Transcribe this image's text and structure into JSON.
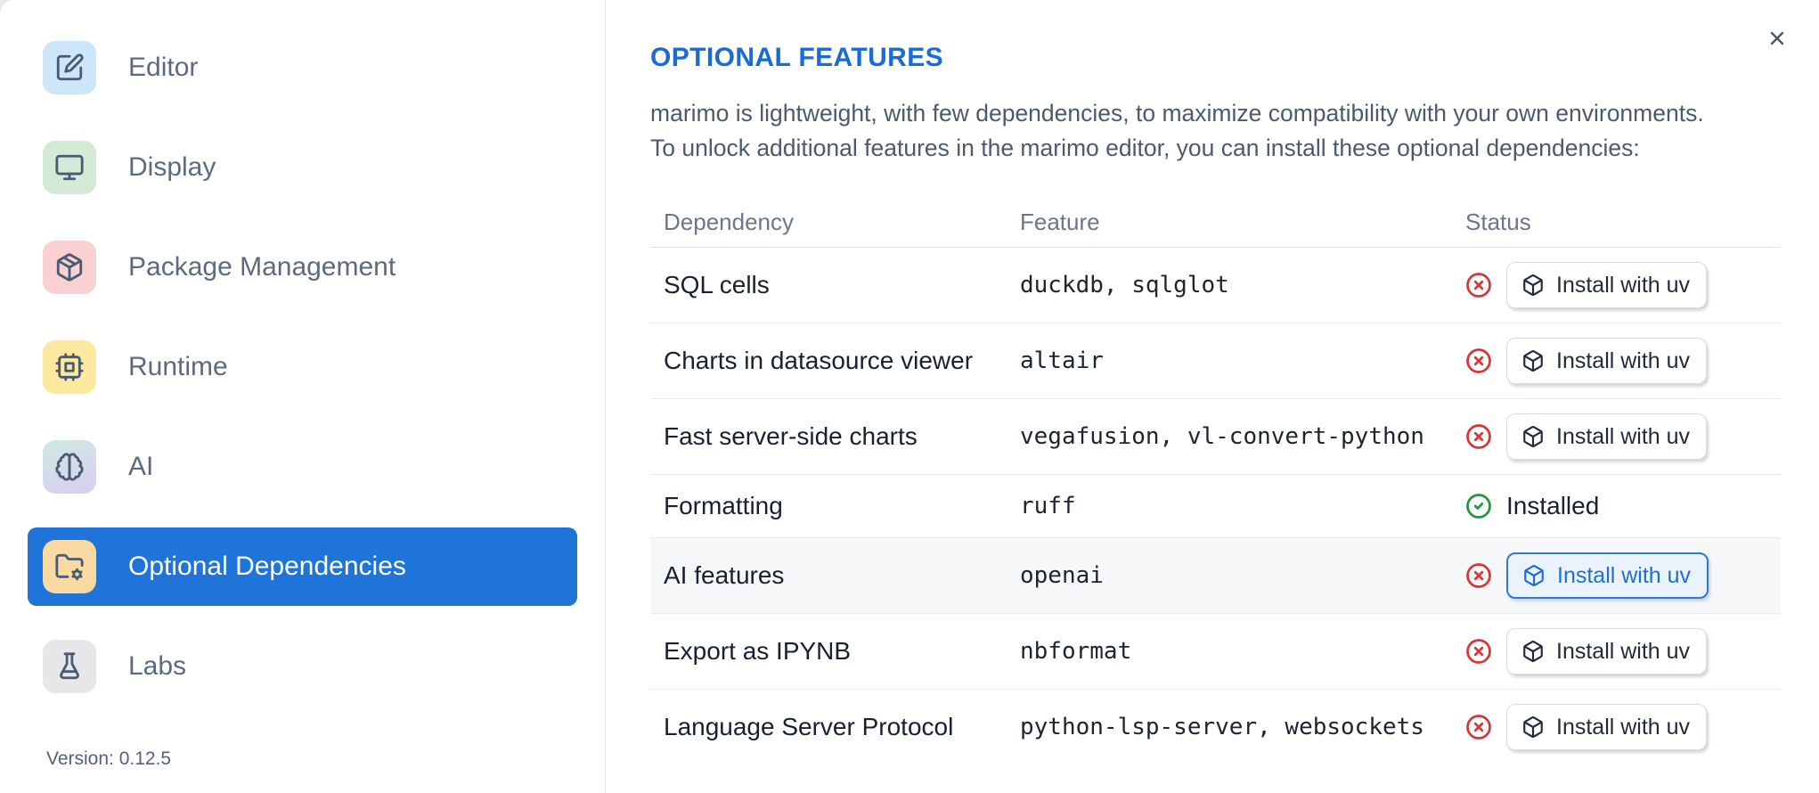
{
  "window": {
    "close_icon": "x-icon"
  },
  "sidebar": {
    "items": [
      {
        "label": "Editor",
        "icon": "square-pen-icon",
        "icon_bg": "#cde6fa"
      },
      {
        "label": "Display",
        "icon": "monitor-icon",
        "icon_bg": "#d5ead6"
      },
      {
        "label": "Package Management",
        "icon": "package-icon",
        "icon_bg": "#fad0d3"
      },
      {
        "label": "Runtime",
        "icon": "cpu-icon",
        "icon_bg": "#fbe9a0"
      },
      {
        "label": "AI",
        "icon": "brain-icon",
        "icon_bg": "linear-gradient(160deg,#cfe9e3,#d9cdf0)"
      },
      {
        "label": "Optional Dependencies",
        "icon": "folder-cog-icon",
        "icon_bg": "#fbd9a3",
        "selected": true
      },
      {
        "label": "Labs",
        "icon": "flask-icon",
        "icon_bg": "#e7e7ea"
      }
    ],
    "version_label": "Version: 0.12.5"
  },
  "panel": {
    "title": "OPTIONAL FEATURES",
    "description_line1": "marimo is lightweight, with few dependencies, to maximize compatibility with your own environments.",
    "description_line2": "To unlock additional features in the marimo editor, you can install these optional dependencies:",
    "table": {
      "headers": [
        "Dependency",
        "Feature",
        "Status"
      ],
      "rows": [
        {
          "dependency": "SQL cells",
          "feature": "duckdb, sqlglot",
          "status": "missing",
          "action_label": "Install with uv"
        },
        {
          "dependency": "Charts in datasource viewer",
          "feature": "altair",
          "status": "missing",
          "action_label": "Install with uv"
        },
        {
          "dependency": "Fast server-side charts",
          "feature": "vegafusion, vl-convert-python",
          "status": "missing",
          "action_label": "Install with uv"
        },
        {
          "dependency": "Formatting",
          "feature": "ruff",
          "status": "installed",
          "status_label": "Installed"
        },
        {
          "dependency": "AI features",
          "feature": "openai",
          "status": "missing",
          "action_label": "Install with uv",
          "highlighted": true
        },
        {
          "dependency": "Export as IPYNB",
          "feature": "nbformat",
          "status": "missing",
          "action_label": "Install with uv"
        },
        {
          "dependency": "Language Server Protocol",
          "feature": "python-lsp-server, websockets",
          "status": "missing",
          "action_label": "Install with uv"
        }
      ]
    }
  },
  "colors": {
    "accent_blue": "#1e74d8",
    "title_blue": "#1a6bd3",
    "error_red": "#d63838",
    "success_green": "#27953f",
    "highlight_button_bg": "#eaf2fc",
    "highlight_button_border": "#2e7ad1",
    "highlighted_row_bg": "#f6f7f9"
  }
}
